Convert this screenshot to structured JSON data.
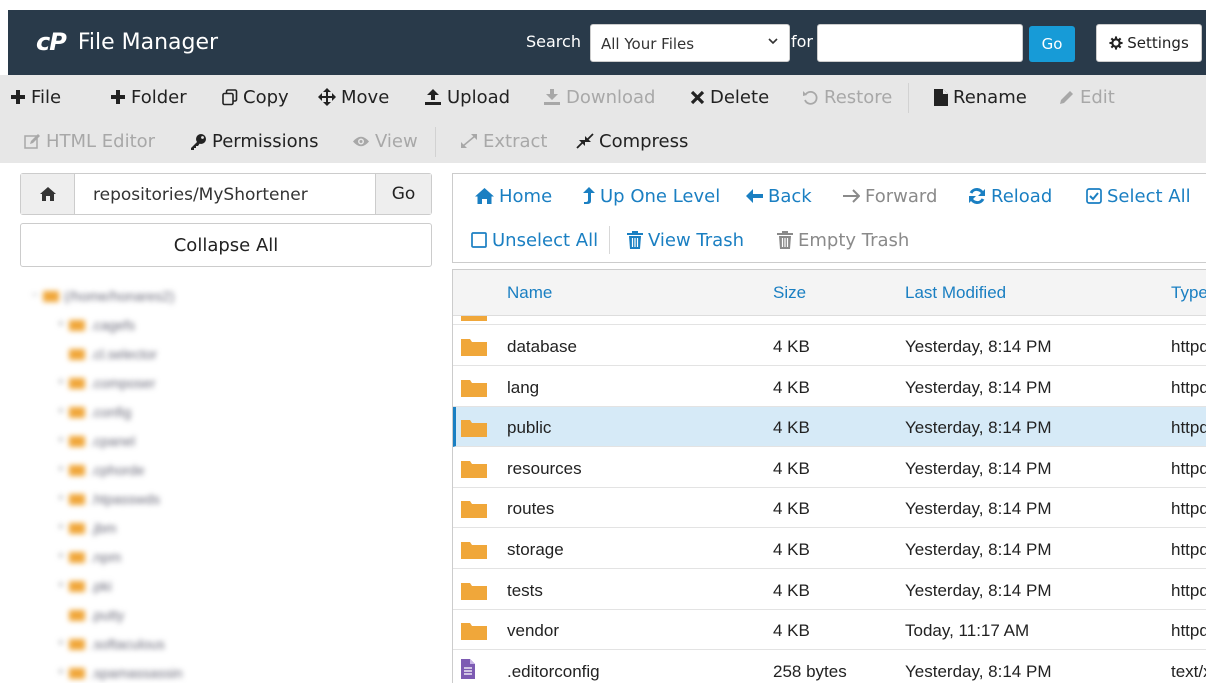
{
  "header": {
    "logo": "cP",
    "title": "File Manager",
    "search_label": "Search",
    "search_scope": "All Your Files",
    "for_label": "for",
    "search_value": "",
    "go_label": "Go",
    "settings_label": "Settings"
  },
  "toolbar": {
    "row1": [
      {
        "label": "File",
        "icon": "plus-icon",
        "disabled": false
      },
      {
        "label": "Folder",
        "icon": "plus-icon",
        "disabled": false
      },
      {
        "label": "Copy",
        "icon": "copy-icon",
        "disabled": false
      },
      {
        "label": "Move",
        "icon": "move-icon",
        "disabled": false
      },
      {
        "label": "Upload",
        "icon": "upload-icon",
        "disabled": false
      },
      {
        "label": "Download",
        "icon": "download-icon",
        "disabled": true
      },
      {
        "label": "Delete",
        "icon": "x-icon",
        "disabled": false
      },
      {
        "label": "Restore",
        "icon": "undo-icon",
        "disabled": true
      },
      {
        "label": "Rename",
        "icon": "file-icon",
        "disabled": false
      },
      {
        "label": "Edit",
        "icon": "pencil-icon",
        "disabled": true
      }
    ],
    "row2": [
      {
        "label": "HTML Editor",
        "icon": "edit-box-icon",
        "disabled": true
      },
      {
        "label": "Permissions",
        "icon": "key-icon",
        "disabled": false
      },
      {
        "label": "View",
        "icon": "eye-icon",
        "disabled": true
      },
      {
        "label": "Extract",
        "icon": "expand-icon",
        "disabled": true
      },
      {
        "label": "Compress",
        "icon": "compress-icon",
        "disabled": false
      }
    ]
  },
  "left": {
    "path": "repositories/MyShortener",
    "go_label": "Go",
    "collapse_label": "Collapse All",
    "tree": [
      {
        "label": "(/home/honares2)",
        "level": 0,
        "expander": "−"
      },
      {
        "label": ".cagefs",
        "level": 1,
        "expander": "+"
      },
      {
        "label": ".cl.selector",
        "level": 1,
        "expander": ""
      },
      {
        "label": ".composer",
        "level": 1,
        "expander": "+"
      },
      {
        "label": ".config",
        "level": 1,
        "expander": "+"
      },
      {
        "label": ".cpanel",
        "level": 1,
        "expander": "+"
      },
      {
        "label": ".cphorde",
        "level": 1,
        "expander": "+"
      },
      {
        "label": ".htpasswds",
        "level": 1,
        "expander": "+"
      },
      {
        "label": ".jbm",
        "level": 1,
        "expander": "+"
      },
      {
        "label": ".npm",
        "level": 1,
        "expander": "+"
      },
      {
        "label": ".pki",
        "level": 1,
        "expander": "+"
      },
      {
        "label": ".putty",
        "level": 1,
        "expander": ""
      },
      {
        "label": ".softaculous",
        "level": 1,
        "expander": "+"
      },
      {
        "label": ".spamassassin",
        "level": 1,
        "expander": "+"
      }
    ]
  },
  "nav": {
    "row1": [
      {
        "label": "Home",
        "icon": "home-icon",
        "disabled": false
      },
      {
        "label": "Up One Level",
        "icon": "up-arrow-icon",
        "disabled": false
      },
      {
        "label": "Back",
        "icon": "left-arrow-icon",
        "disabled": false
      },
      {
        "label": "Forward",
        "icon": "right-arrow-icon",
        "disabled": true
      },
      {
        "label": "Reload",
        "icon": "reload-icon",
        "disabled": false
      },
      {
        "label": "Select All",
        "icon": "checkbox-checked-icon",
        "disabled": false
      }
    ],
    "row2": [
      {
        "label": "Unselect All",
        "icon": "checkbox-empty-icon",
        "disabled": false
      },
      {
        "label": "View Trash",
        "icon": "trash-icon",
        "disabled": false
      },
      {
        "label": "Empty Trash",
        "icon": "trash-icon",
        "disabled": true
      }
    ]
  },
  "table": {
    "columns": [
      "Name",
      "Size",
      "Last Modified",
      "Type"
    ],
    "rows": [
      {
        "name": "database",
        "size": "4 KB",
        "modified": "Yesterday, 8:14 PM",
        "type": "httpd/unix-directory",
        "kind": "folder",
        "selected": false
      },
      {
        "name": "lang",
        "size": "4 KB",
        "modified": "Yesterday, 8:14 PM",
        "type": "httpd/unix-directory",
        "kind": "folder",
        "selected": false
      },
      {
        "name": "public",
        "size": "4 KB",
        "modified": "Yesterday, 8:14 PM",
        "type": "httpd/unix-directory",
        "kind": "folder",
        "selected": true
      },
      {
        "name": "resources",
        "size": "4 KB",
        "modified": "Yesterday, 8:14 PM",
        "type": "httpd/unix-directory",
        "kind": "folder",
        "selected": false
      },
      {
        "name": "routes",
        "size": "4 KB",
        "modified": "Yesterday, 8:14 PM",
        "type": "httpd/unix-directory",
        "kind": "folder",
        "selected": false
      },
      {
        "name": "storage",
        "size": "4 KB",
        "modified": "Yesterday, 8:14 PM",
        "type": "httpd/unix-directory",
        "kind": "folder",
        "selected": false
      },
      {
        "name": "tests",
        "size": "4 KB",
        "modified": "Yesterday, 8:14 PM",
        "type": "httpd/unix-directory",
        "kind": "folder",
        "selected": false
      },
      {
        "name": "vendor",
        "size": "4 KB",
        "modified": "Today, 11:17 AM",
        "type": "httpd/unix-directory",
        "kind": "folder",
        "selected": false
      },
      {
        "name": ".editorconfig",
        "size": "258 bytes",
        "modified": "Yesterday, 8:14 PM",
        "type": "text/x-generic",
        "kind": "file",
        "selected": false
      }
    ]
  },
  "colors": {
    "header_bg": "#293a4a",
    "accent": "#1a7fc2",
    "go_button": "#179bd7",
    "folder": "#f0a73a",
    "file_icon": "#7d5bb3",
    "selected_row": "#d6eaf7",
    "toolbar_bg": "#e7e7e7"
  }
}
